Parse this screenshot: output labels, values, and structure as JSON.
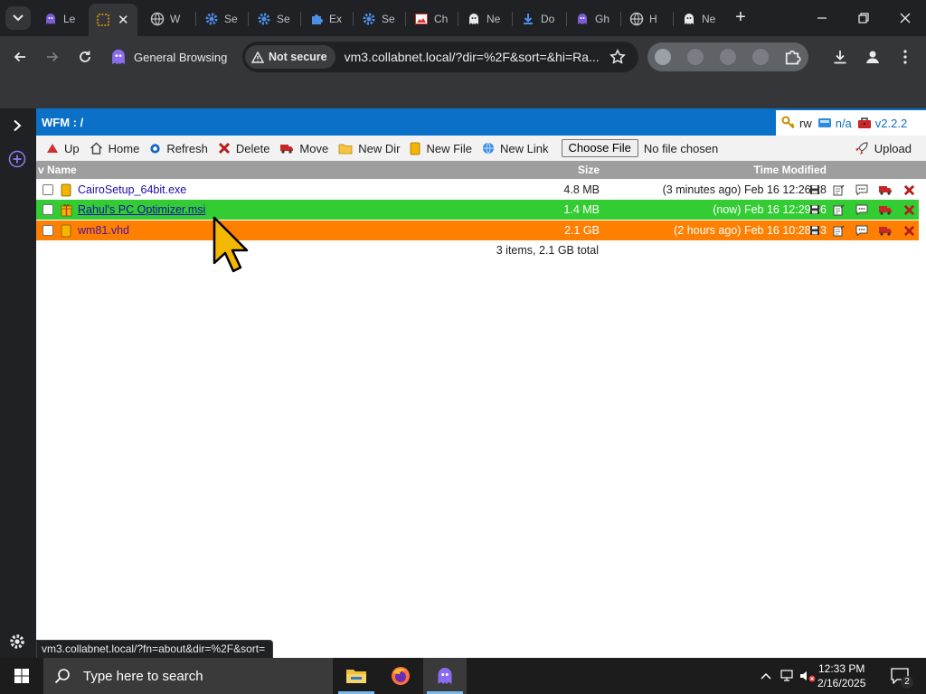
{
  "tabs": [
    {
      "title": "Le",
      "icon": "ghost-icon"
    },
    {
      "title": "",
      "icon": "page-icon",
      "active": true
    },
    {
      "title": "W",
      "icon": "globe-icon"
    },
    {
      "title": "Se",
      "icon": "gear-icon"
    },
    {
      "title": "Se",
      "icon": "gear-icon"
    },
    {
      "title": "Ex",
      "icon": "puzzle-icon"
    },
    {
      "title": "Se",
      "icon": "gear-icon"
    },
    {
      "title": "Ch",
      "icon": "image-icon"
    },
    {
      "title": "Ne",
      "icon": "ghost-icon"
    },
    {
      "title": "Do",
      "icon": "download-icon"
    },
    {
      "title": "Gh",
      "icon": "ghost-icon"
    },
    {
      "title": "H",
      "icon": "globe-icon"
    },
    {
      "title": "Ne",
      "icon": "ghost-icon"
    }
  ],
  "toolbar": {
    "profile_label": "General Browsing",
    "security_label": "Not secure",
    "url": "vm3.collabnet.local/?dir=%2F&sort=&hi=Ra..."
  },
  "wfm": {
    "title": "WFM : /",
    "status": {
      "perm": "rw",
      "disk": "n/a",
      "version": "v2.2.2"
    },
    "buttons": {
      "up": "Up",
      "home": "Home",
      "refresh": "Refresh",
      "delete": "Delete",
      "move": "Move",
      "new_dir": "New Dir",
      "new_file": "New File",
      "new_link": "New Link",
      "choose_file": "Choose File",
      "no_file": "No file chosen",
      "upload": "Upload"
    },
    "columns": {
      "name": "v Name",
      "size": "Size",
      "time": "Time Modified"
    },
    "files": [
      {
        "name": "CairoSetup_64bit.exe",
        "size": "4.8 MB",
        "time": "(3 minutes ago) Feb 16 12:26:28",
        "icon": "file-icon",
        "highlight": "none"
      },
      {
        "name": "Rahul's PC Optimizer.msi",
        "size": "1.4 MB",
        "time": "(now) Feb 16 12:29:56",
        "icon": "gift-icon",
        "highlight": "green"
      },
      {
        "name": "wm81.vhd",
        "size": "2.1 GB",
        "time": "(2 hours ago) Feb 16 10:28:43",
        "icon": "file-icon",
        "highlight": "orange"
      }
    ],
    "summary": "3 items, 2.1 GB total"
  },
  "status_url": "vm3.collabnet.local/?fn=about&dir=%2F&sort=",
  "taskbar": {
    "search_placeholder": "Type here to search",
    "time": "12:33 PM",
    "date": "2/16/2025",
    "notification_count": "2"
  },
  "colors": {
    "wfm_header": "#0a70c8",
    "row_green": "#33cc33",
    "row_orange": "#ff8000",
    "link": "#1a0dab"
  }
}
